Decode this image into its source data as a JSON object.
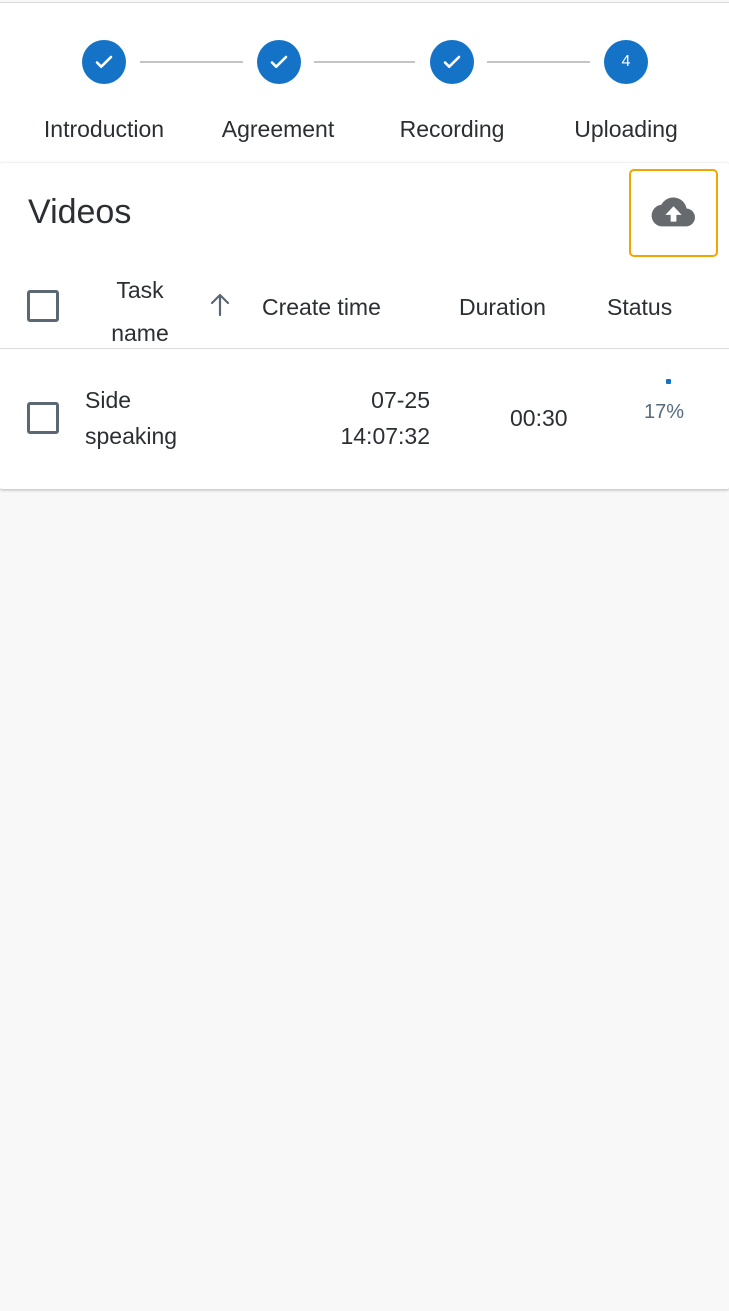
{
  "stepper": {
    "steps": [
      {
        "label": "Introduction",
        "state": "completed"
      },
      {
        "label": "Agreement",
        "state": "completed"
      },
      {
        "label": "Recording",
        "state": "completed"
      },
      {
        "label": "Uploading",
        "state": "active",
        "number": "4"
      }
    ]
  },
  "videos": {
    "title": "Videos",
    "upload_icon": "cloud-upload-icon",
    "columns": {
      "task_name": "Task name",
      "create_time": "Create time",
      "duration": "Duration",
      "status": "Status"
    },
    "sort": {
      "column": "task_name",
      "direction": "ascending"
    },
    "rows": [
      {
        "task_name_line1": "Side",
        "task_name_line2": "speaking",
        "create_date": "07-25",
        "create_clock": "14:07:32",
        "duration": "00:30",
        "progress_text": "17%",
        "progress": 0.17
      }
    ]
  },
  "colors": {
    "accent": "#1573c7",
    "highlight": "#f0a500",
    "text": "#2b2f33",
    "background": "#f8f8f8"
  }
}
